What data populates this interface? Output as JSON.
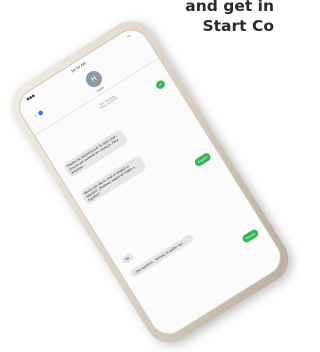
{
  "headline": {
    "line1": "and get in",
    "line2": "Start Co"
  },
  "phone": {
    "status_time": "10:30 AM",
    "contact_initial": "H",
    "contact_name": "Hotel",
    "timestamp_line1": "Text Message",
    "timestamp_line2": "Today 10:30 AM",
    "messages": [
      {
        "from": "out",
        "text": "Hi"
      },
      {
        "from": "in",
        "text": "Thanks for reaching out! To start chat... Gracias por ponerte en contacto. Para empezar..."
      },
      {
        "from": "in",
        "text": "Would you like to chat in English or Spanish? ¿Prefieres hablar en inglés o Español?"
      },
      {
        "from": "out",
        "text": "English"
      },
      {
        "from": "in",
        "text": "Ok."
      },
      {
        "from": "in",
        "text": "...the question... female, or prefer not..."
      },
      {
        "from": "out",
        "text": "Female"
      }
    ]
  },
  "colors": {
    "outgoing_bubble": "#35b556",
    "incoming_bubble": "#e6e6e9",
    "phone_frame": "#d8cfc2"
  }
}
